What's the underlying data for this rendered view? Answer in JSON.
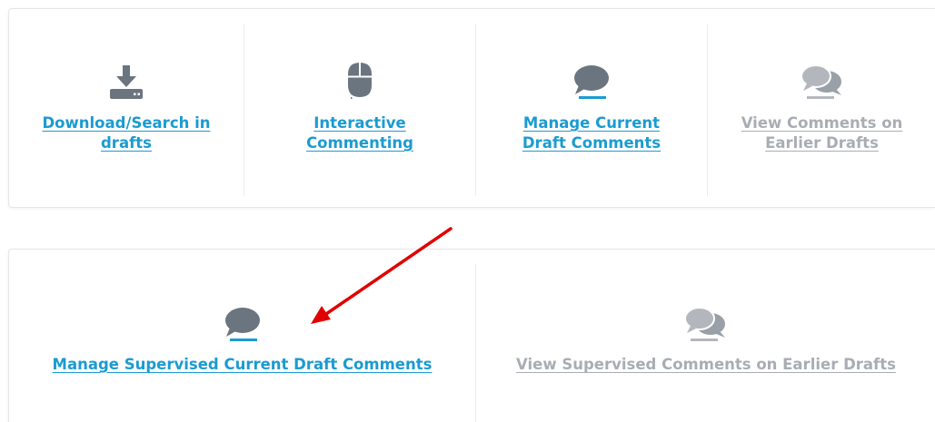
{
  "top_panel": {
    "tiles": [
      {
        "label_line1": "Download/Search in",
        "label_line2": "drafts",
        "icon": "download-icon",
        "state": "active"
      },
      {
        "label_line1": "Interactive",
        "label_line2": "Commenting",
        "icon": "mouse-icon",
        "state": "active"
      },
      {
        "label_line1": "Manage Current",
        "label_line2": "Draft Comments",
        "icon": "comment-icon",
        "state": "active"
      },
      {
        "label_line1": "View Comments on",
        "label_line2": "Earlier Drafts",
        "icon": "comments-icon",
        "state": "disabled"
      }
    ]
  },
  "bottom_panel": {
    "tiles": [
      {
        "label": "Manage Supervised Current Draft Comments",
        "icon": "comment-icon",
        "state": "active"
      },
      {
        "label": "View Supervised Comments on Earlier Drafts",
        "icon": "comments-icon",
        "state": "disabled"
      }
    ]
  },
  "annotation": {
    "icon": "red-arrow-icon",
    "color": "#e00000"
  },
  "colors": {
    "link_active": "#1b9bd1",
    "link_muted": "#a9adb3",
    "icon_dark": "#6b7580",
    "icon_muted": "#b3b7bd",
    "accent_underline": "#1b9bd1"
  }
}
